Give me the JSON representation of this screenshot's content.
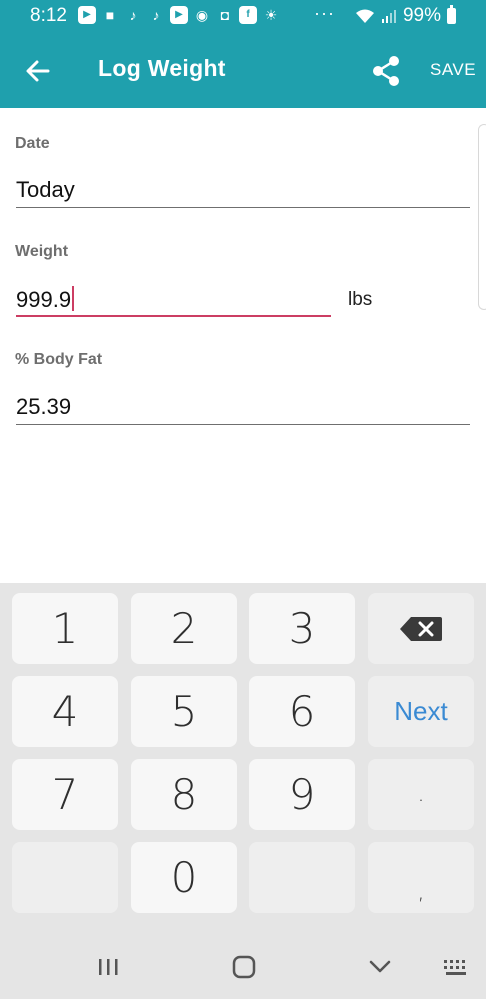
{
  "status_bar": {
    "time": "8:12",
    "battery_percent": "99%",
    "overflow_dots": "···",
    "icons": [
      "youtube-icon",
      "video-camera-icon",
      "tiktok-icon",
      "tiktok-icon",
      "youtube-icon",
      "account-icon",
      "shopping-bag-icon",
      "facebook-icon",
      "weather-icon"
    ]
  },
  "app_bar": {
    "title": "Log Weight",
    "save_label": "SAVE",
    "background_color": "#1fa0ad"
  },
  "form": {
    "date": {
      "label": "Date",
      "value": "Today"
    },
    "weight": {
      "label": "Weight",
      "value": "999.9",
      "unit": "lbs"
    },
    "body_fat": {
      "label": "% Body Fat",
      "value": "25.39"
    }
  },
  "keyboard": {
    "keys": [
      "1",
      "2",
      "3",
      "4",
      "5",
      "6",
      "7",
      "8",
      "9",
      "0"
    ],
    "next_label": "Next",
    "dot_label": ".",
    "comma_label": ","
  },
  "colors": {
    "accent": "#1fa0ad",
    "active_field": "#cc3d63",
    "next_key": "#3a8ad3"
  }
}
